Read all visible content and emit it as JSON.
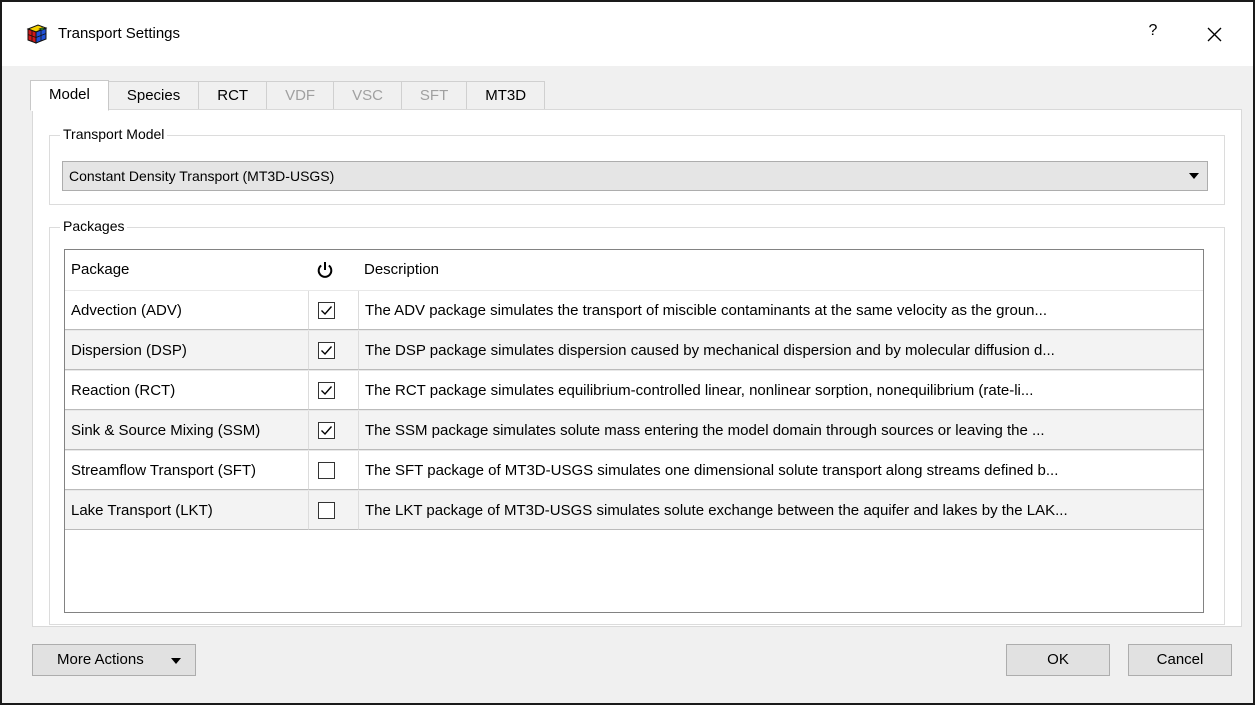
{
  "window": {
    "title": "Transport Settings",
    "help_label": "?"
  },
  "tabs": [
    {
      "label": "Model",
      "state": "active"
    },
    {
      "label": "Species",
      "state": "enabled"
    },
    {
      "label": "RCT",
      "state": "enabled"
    },
    {
      "label": "VDF",
      "state": "disabled"
    },
    {
      "label": "VSC",
      "state": "disabled"
    },
    {
      "label": "SFT",
      "state": "disabled"
    },
    {
      "label": "MT3D",
      "state": "enabled"
    }
  ],
  "transport_model": {
    "group_label": "Transport Model",
    "selected": "Constant Density Transport (MT3D-USGS)"
  },
  "packages": {
    "group_label": "Packages",
    "columns": {
      "package": "Package",
      "enabled_icon": "power-icon",
      "description": "Description"
    },
    "rows": [
      {
        "package": "Advection (ADV)",
        "enabled": true,
        "description": "The ADV package simulates the transport of miscible contaminants at the same velocity as the groun..."
      },
      {
        "package": "Dispersion (DSP)",
        "enabled": true,
        "description": "The DSP package simulates dispersion caused by mechanical dispersion and by molecular diffusion d..."
      },
      {
        "package": "Reaction (RCT)",
        "enabled": true,
        "description": "The RCT package simulates equilibrium-controlled linear, nonlinear sorption, nonequilibrium (rate-li..."
      },
      {
        "package": "Sink & Source Mixing (SSM)",
        "enabled": true,
        "description": "The SSM package simulates solute mass entering the model domain through sources or leaving the ..."
      },
      {
        "package": "Streamflow Transport (SFT)",
        "enabled": false,
        "description": "The SFT package of MT3D-USGS simulates one dimensional solute transport along streams defined b..."
      },
      {
        "package": "Lake Transport (LKT)",
        "enabled": false,
        "description": "The LKT package of MT3D-USGS simulates solute exchange between the aquifer and lakes by the LAK..."
      }
    ]
  },
  "buttons": {
    "more_actions": "More Actions",
    "ok": "OK",
    "cancel": "Cancel"
  }
}
